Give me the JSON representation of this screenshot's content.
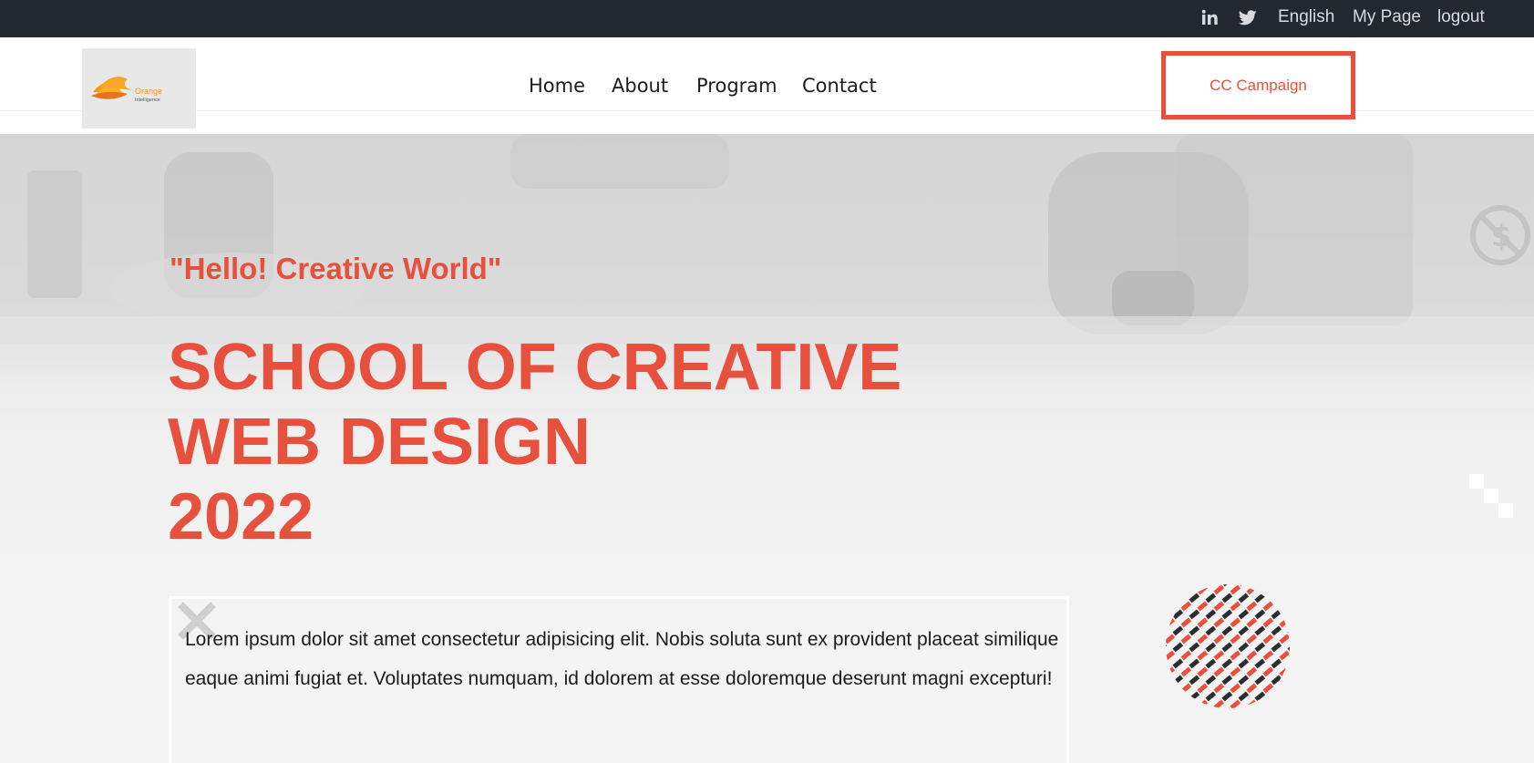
{
  "topbar": {
    "linkedin_icon": "linkedin-icon",
    "twitter_icon": "twitter-icon",
    "language": "English",
    "my_page": "My Page",
    "logout": "logout"
  },
  "header": {
    "logo": {
      "name": "orange-intelligence-logo",
      "text_top": "Orange",
      "text_bottom": "Intelligence"
    },
    "nav": [
      "Home",
      "About",
      "Program",
      "Contact"
    ],
    "cta_label": "CC Campaign"
  },
  "hero": {
    "tagline": "\"Hello! Creative World\"",
    "headline_lines": [
      "SCHOOL OF CREATIVE",
      "WEB DESIGN",
      "2022"
    ],
    "description": "Lorem ipsum dolor sit amet consectetur adipisicing elit. Nobis soluta sunt ex provident placeat similique eaque animi fugiat et. Voluptates numquam, id dolorem at esse doloremque deserunt magni excepturi!"
  },
  "colors": {
    "accent": "#ea4f3d",
    "topbar_bg": "#23272f",
    "text_dark": "#1c1c1c"
  }
}
